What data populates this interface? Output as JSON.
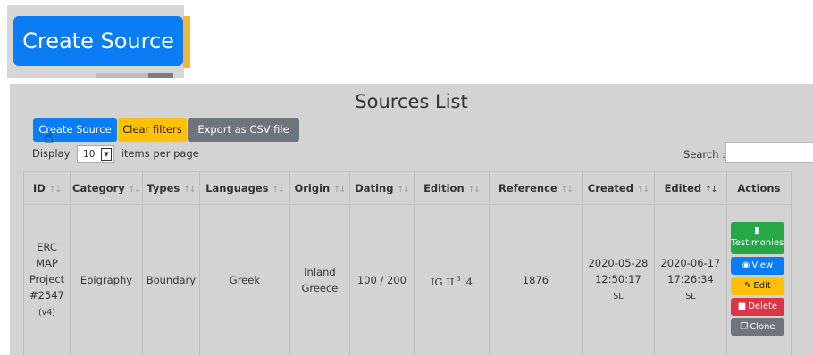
{
  "zoom": {
    "button_label": "Create Source"
  },
  "page": {
    "title": "Sources List"
  },
  "toolbar": {
    "create_label": "Create Source",
    "clear_label": "Clear filters",
    "export_label": "Export as CSV file"
  },
  "display": {
    "prefix": "Display",
    "page_size": "10",
    "suffix": "items per page"
  },
  "search": {
    "label": "Search :",
    "value": ""
  },
  "table": {
    "headers": {
      "id": "ID",
      "category": "Category",
      "types": "Types",
      "languages": "Languages",
      "origin": "Origin",
      "dating": "Dating",
      "edition": "Edition",
      "reference": "Reference",
      "created": "Created",
      "edited": "Edited",
      "actions": "Actions"
    },
    "row": {
      "id_line1": "ERC",
      "id_line2": "MAP",
      "id_line3": "Project",
      "id_line4": "#2547",
      "id_version": "(v4)",
      "category": "Epigraphy",
      "types": "Boundary",
      "languages": "Greek",
      "origin_line1": "Inland",
      "origin_line2": "Greece",
      "dating": "100 / 200",
      "edition_main": "IG II",
      "edition_sup": "3",
      "edition_suffix": ".4",
      "reference": "1876",
      "created_date": "2020-05-28",
      "created_time": "12:50:17",
      "created_by": "SL",
      "edited_date": "2020-06-17",
      "edited_time": "17:26:34",
      "edited_by": "SL"
    },
    "actions": {
      "testimonies": "Testimonies",
      "view": "View",
      "edit": "Edit",
      "delete": "Delete",
      "clone": "Clone"
    }
  },
  "colors": {
    "primary": "#0a7cf4",
    "warning": "#ffc107",
    "secondary": "#6c757d",
    "success": "#28a745",
    "danger": "#dc3545"
  }
}
